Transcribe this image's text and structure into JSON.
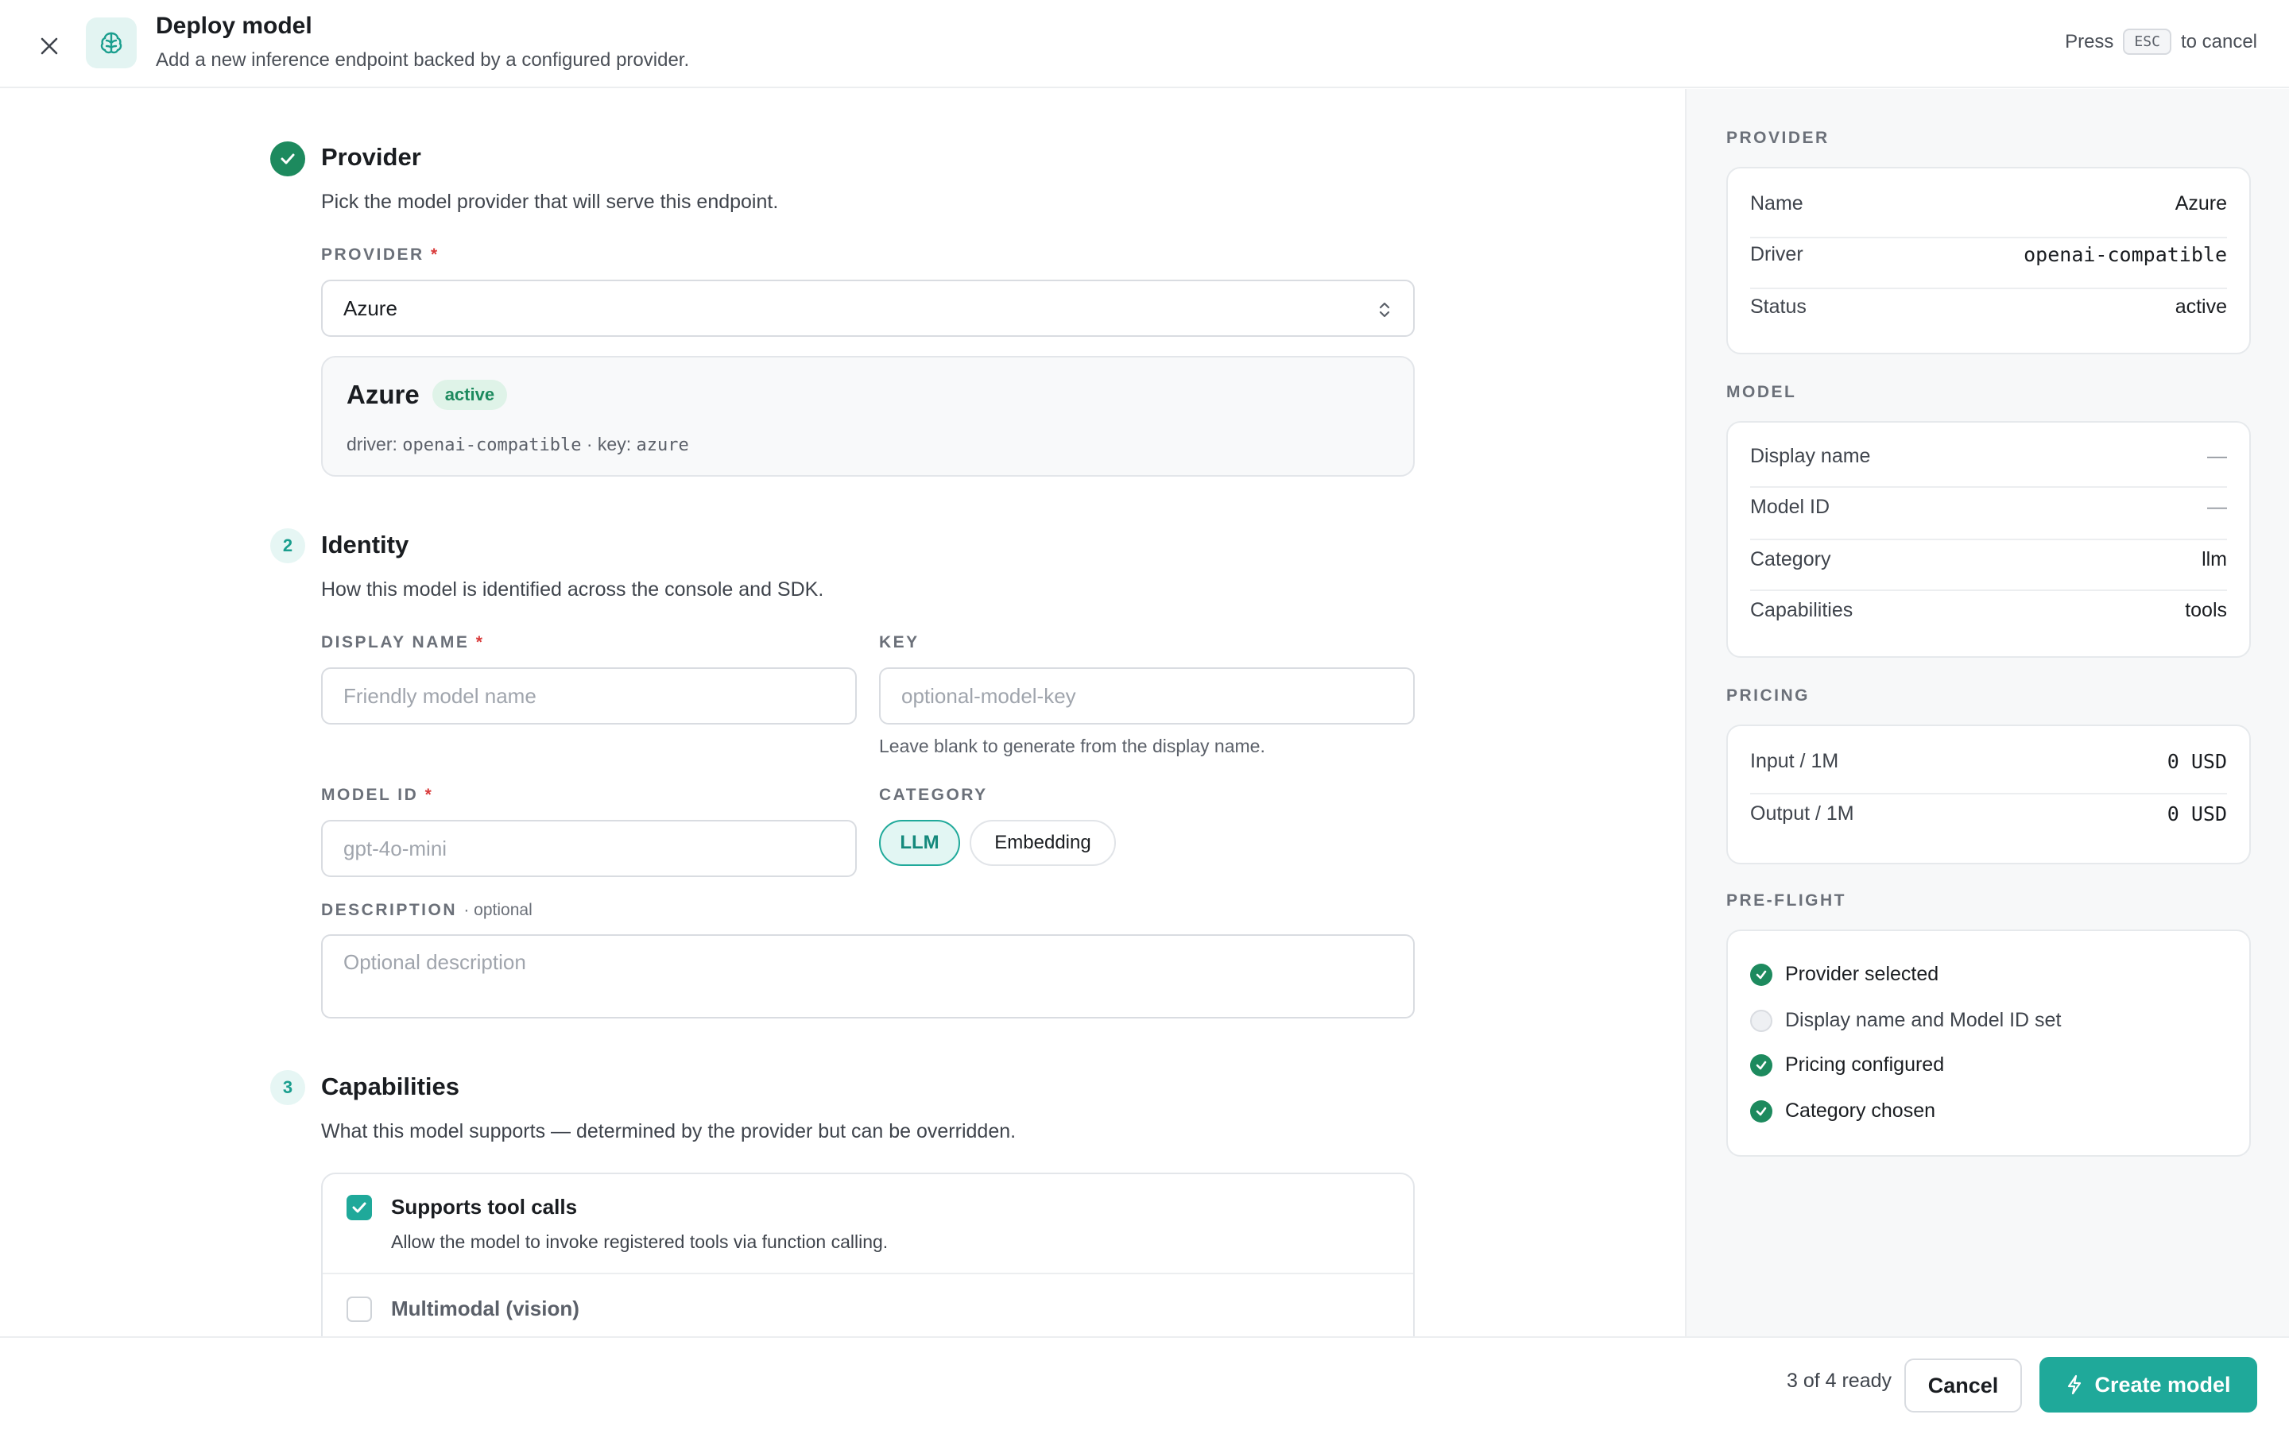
{
  "header": {
    "title": "Deploy model",
    "subtitle": "Add a new inference endpoint backed by a configured provider.",
    "esc_prefix": "Press",
    "esc_key": "ESC",
    "esc_suffix": "to cancel"
  },
  "provider_section": {
    "step_state": "done",
    "title": "Provider",
    "description": "Pick the model provider that will serve this endpoint.",
    "field_label": "PROVIDER",
    "selected": "Azure",
    "card": {
      "name": "Azure",
      "status": "active",
      "driver_label": "driver:",
      "driver_value": "openai-compatible",
      "separator": "·",
      "key_label": "key:",
      "key_value": "azure"
    }
  },
  "identity_section": {
    "step": "2",
    "title": "Identity",
    "description": "How this model is identified across the console and SDK.",
    "display_name_label": "DISPLAY NAME",
    "display_name_placeholder": "Friendly model name",
    "key_label": "KEY",
    "key_placeholder": "optional-model-key",
    "key_hint": "Leave blank to generate from the display name.",
    "model_id_label": "MODEL ID",
    "model_id_placeholder": "gpt-4o-mini",
    "category_label": "CATEGORY",
    "category_options": [
      "LLM",
      "Embedding"
    ],
    "category_selected": "LLM",
    "description_label": "DESCRIPTION",
    "description_optional": "· optional",
    "description_placeholder": "Optional description"
  },
  "capabilities_section": {
    "step": "3",
    "title": "Capabilities",
    "description": "What this model supports — determined by the provider but can be overridden.",
    "items": [
      {
        "title": "Supports tool calls",
        "desc": "Allow the model to invoke registered tools via function calling.",
        "checked": true
      },
      {
        "title": "Multimodal (vision)",
        "desc": "",
        "checked": false
      }
    ]
  },
  "sidebar": {
    "provider": {
      "label": "PROVIDER",
      "rows": [
        {
          "k": "Name",
          "v": "Azure"
        },
        {
          "k": "Driver",
          "v": "openai-compatible"
        },
        {
          "k": "Status",
          "v": "active"
        }
      ]
    },
    "model": {
      "label": "MODEL",
      "rows": [
        {
          "k": "Display name",
          "v": "—"
        },
        {
          "k": "Model ID",
          "v": "—"
        },
        {
          "k": "Category",
          "v": "llm"
        },
        {
          "k": "Capabilities",
          "v": "tools"
        }
      ]
    },
    "pricing": {
      "label": "PRICING",
      "rows": [
        {
          "k": "Input / 1M",
          "v": "0 USD"
        },
        {
          "k": "Output / 1M",
          "v": "0 USD"
        }
      ]
    },
    "preflight": {
      "label": "PRE-FLIGHT",
      "items": [
        {
          "label": "Provider selected",
          "done": true
        },
        {
          "label": "Display name and Model ID set",
          "done": false
        },
        {
          "label": "Pricing configured",
          "done": true
        },
        {
          "label": "Category chosen",
          "done": true
        }
      ]
    }
  },
  "footer": {
    "ready_text": "3 of 4 ready",
    "cancel_label": "Cancel",
    "create_label": "Create model"
  },
  "colors": {
    "accent": "#1fa99a",
    "success": "#1d8a5e",
    "required": "#d93b3b"
  },
  "icons": [
    "close-icon",
    "brain-icon",
    "check-icon",
    "chevron-updown-icon",
    "bolt-icon"
  ]
}
